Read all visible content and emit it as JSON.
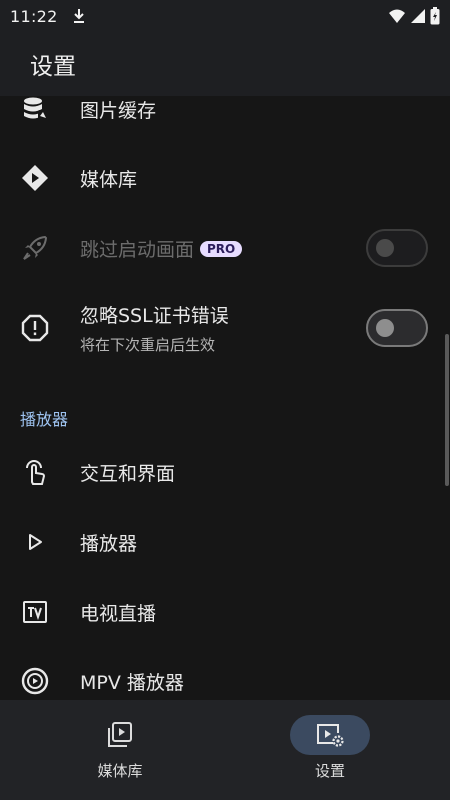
{
  "status_bar": {
    "time": "11:22"
  },
  "app_bar": {
    "title": "设置"
  },
  "settings": {
    "image_cache": {
      "label": "图片缓存",
      "icon": "database-icon"
    },
    "media_library": {
      "label": "媒体库",
      "icon": "media-library-icon"
    },
    "skip_splash": {
      "label": "跳过启动画面",
      "badge": "PRO",
      "enabled": false,
      "toggle_on": false,
      "icon": "rocket-icon"
    },
    "ignore_ssl": {
      "label": "忽略SSL证书错误",
      "subtitle": "将在下次重启后生效",
      "toggle_on": false,
      "icon": "alert-icon"
    }
  },
  "player_section": {
    "header": "播放器",
    "items": [
      {
        "label": "交互和界面",
        "icon": "touch-icon"
      },
      {
        "label": "播放器",
        "icon": "play-icon"
      },
      {
        "label": "电视直播",
        "icon": "tv-icon"
      },
      {
        "label": "MPV 播放器",
        "icon": "mpv-icon"
      }
    ]
  },
  "bottom_nav": {
    "items": [
      {
        "label": "媒体库",
        "icon": "media-library-icon",
        "active": false
      },
      {
        "label": "设置",
        "icon": "settings-icon",
        "active": true
      }
    ]
  },
  "colors": {
    "accent": "#9ec3f0",
    "active_pill": "#3b4a60",
    "background": "#161616",
    "bar": "#1e1f22",
    "pro_badge_bg": "#e7dcff"
  }
}
